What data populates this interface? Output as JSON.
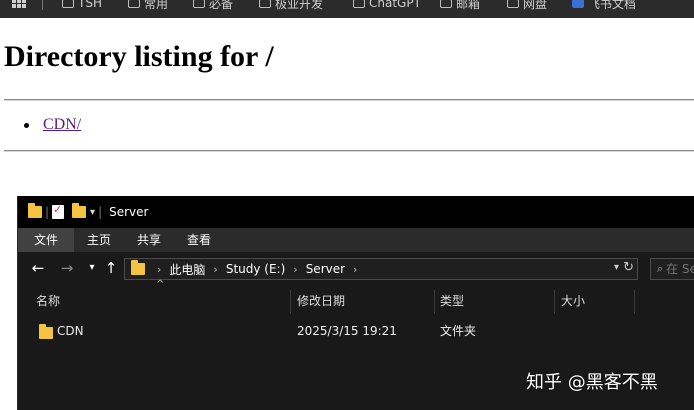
{
  "bookmarks": {
    "items": [
      {
        "label": "TSH"
      },
      {
        "label": "常用"
      },
      {
        "label": "必备"
      },
      {
        "label": "极业开发"
      },
      {
        "label": "ChatGPT"
      },
      {
        "label": "邮箱"
      },
      {
        "label": "网盘"
      },
      {
        "label": "飞书文档"
      }
    ]
  },
  "listing": {
    "title": "Directory listing for /",
    "items": [
      {
        "label": "CDN/"
      }
    ]
  },
  "explorer": {
    "title": "Server",
    "ribbon_tabs": [
      {
        "label": "文件",
        "active": true
      },
      {
        "label": "主页"
      },
      {
        "label": "共享"
      },
      {
        "label": "查看"
      }
    ],
    "breadcrumbs": [
      "此电脑",
      "Study (E:)",
      "Server"
    ],
    "search_placeholder": "在 Server 中搜索",
    "columns": [
      "名称",
      "修改日期",
      "类型",
      "大小"
    ],
    "rows": [
      {
        "name": "CDN",
        "modified": "2025/3/15 19:21",
        "type": "文件夹",
        "size": ""
      }
    ]
  },
  "watermark": "知乎 @黑客不黑",
  "colors": {
    "explorer_bg": "#191919",
    "titlebar_bg": "#000000",
    "ribbon_bg": "#2b2b2b",
    "folder": "#f5c342",
    "link_visited": "#551a8b"
  }
}
